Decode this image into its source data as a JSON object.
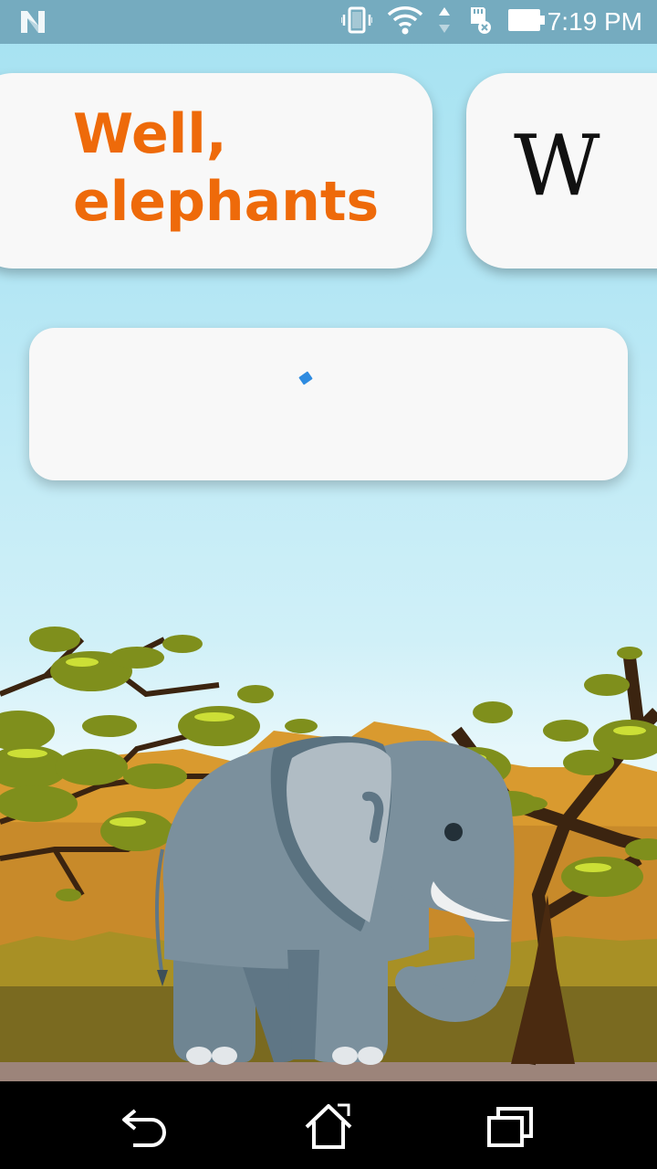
{
  "status_bar": {
    "time": "7:19 PM",
    "icons": [
      "n-logo-icon",
      "vibrate-icon",
      "wifi-icon",
      "data-arrows-icon",
      "sd-card-icon",
      "battery-icon"
    ]
  },
  "title_card": {
    "title_line1": "Well,",
    "title_line2": "elephants"
  },
  "wiki_card": {
    "logo_text": "W"
  },
  "content_card": {
    "loading": true
  },
  "nav_bar": {
    "buttons": [
      "back-icon",
      "home-icon",
      "recents-icon"
    ]
  },
  "colors": {
    "accent": "#ee6a0a",
    "status_bar": "#75abbf",
    "card": "#f8f8f8",
    "spinner": "#2e8be0"
  }
}
